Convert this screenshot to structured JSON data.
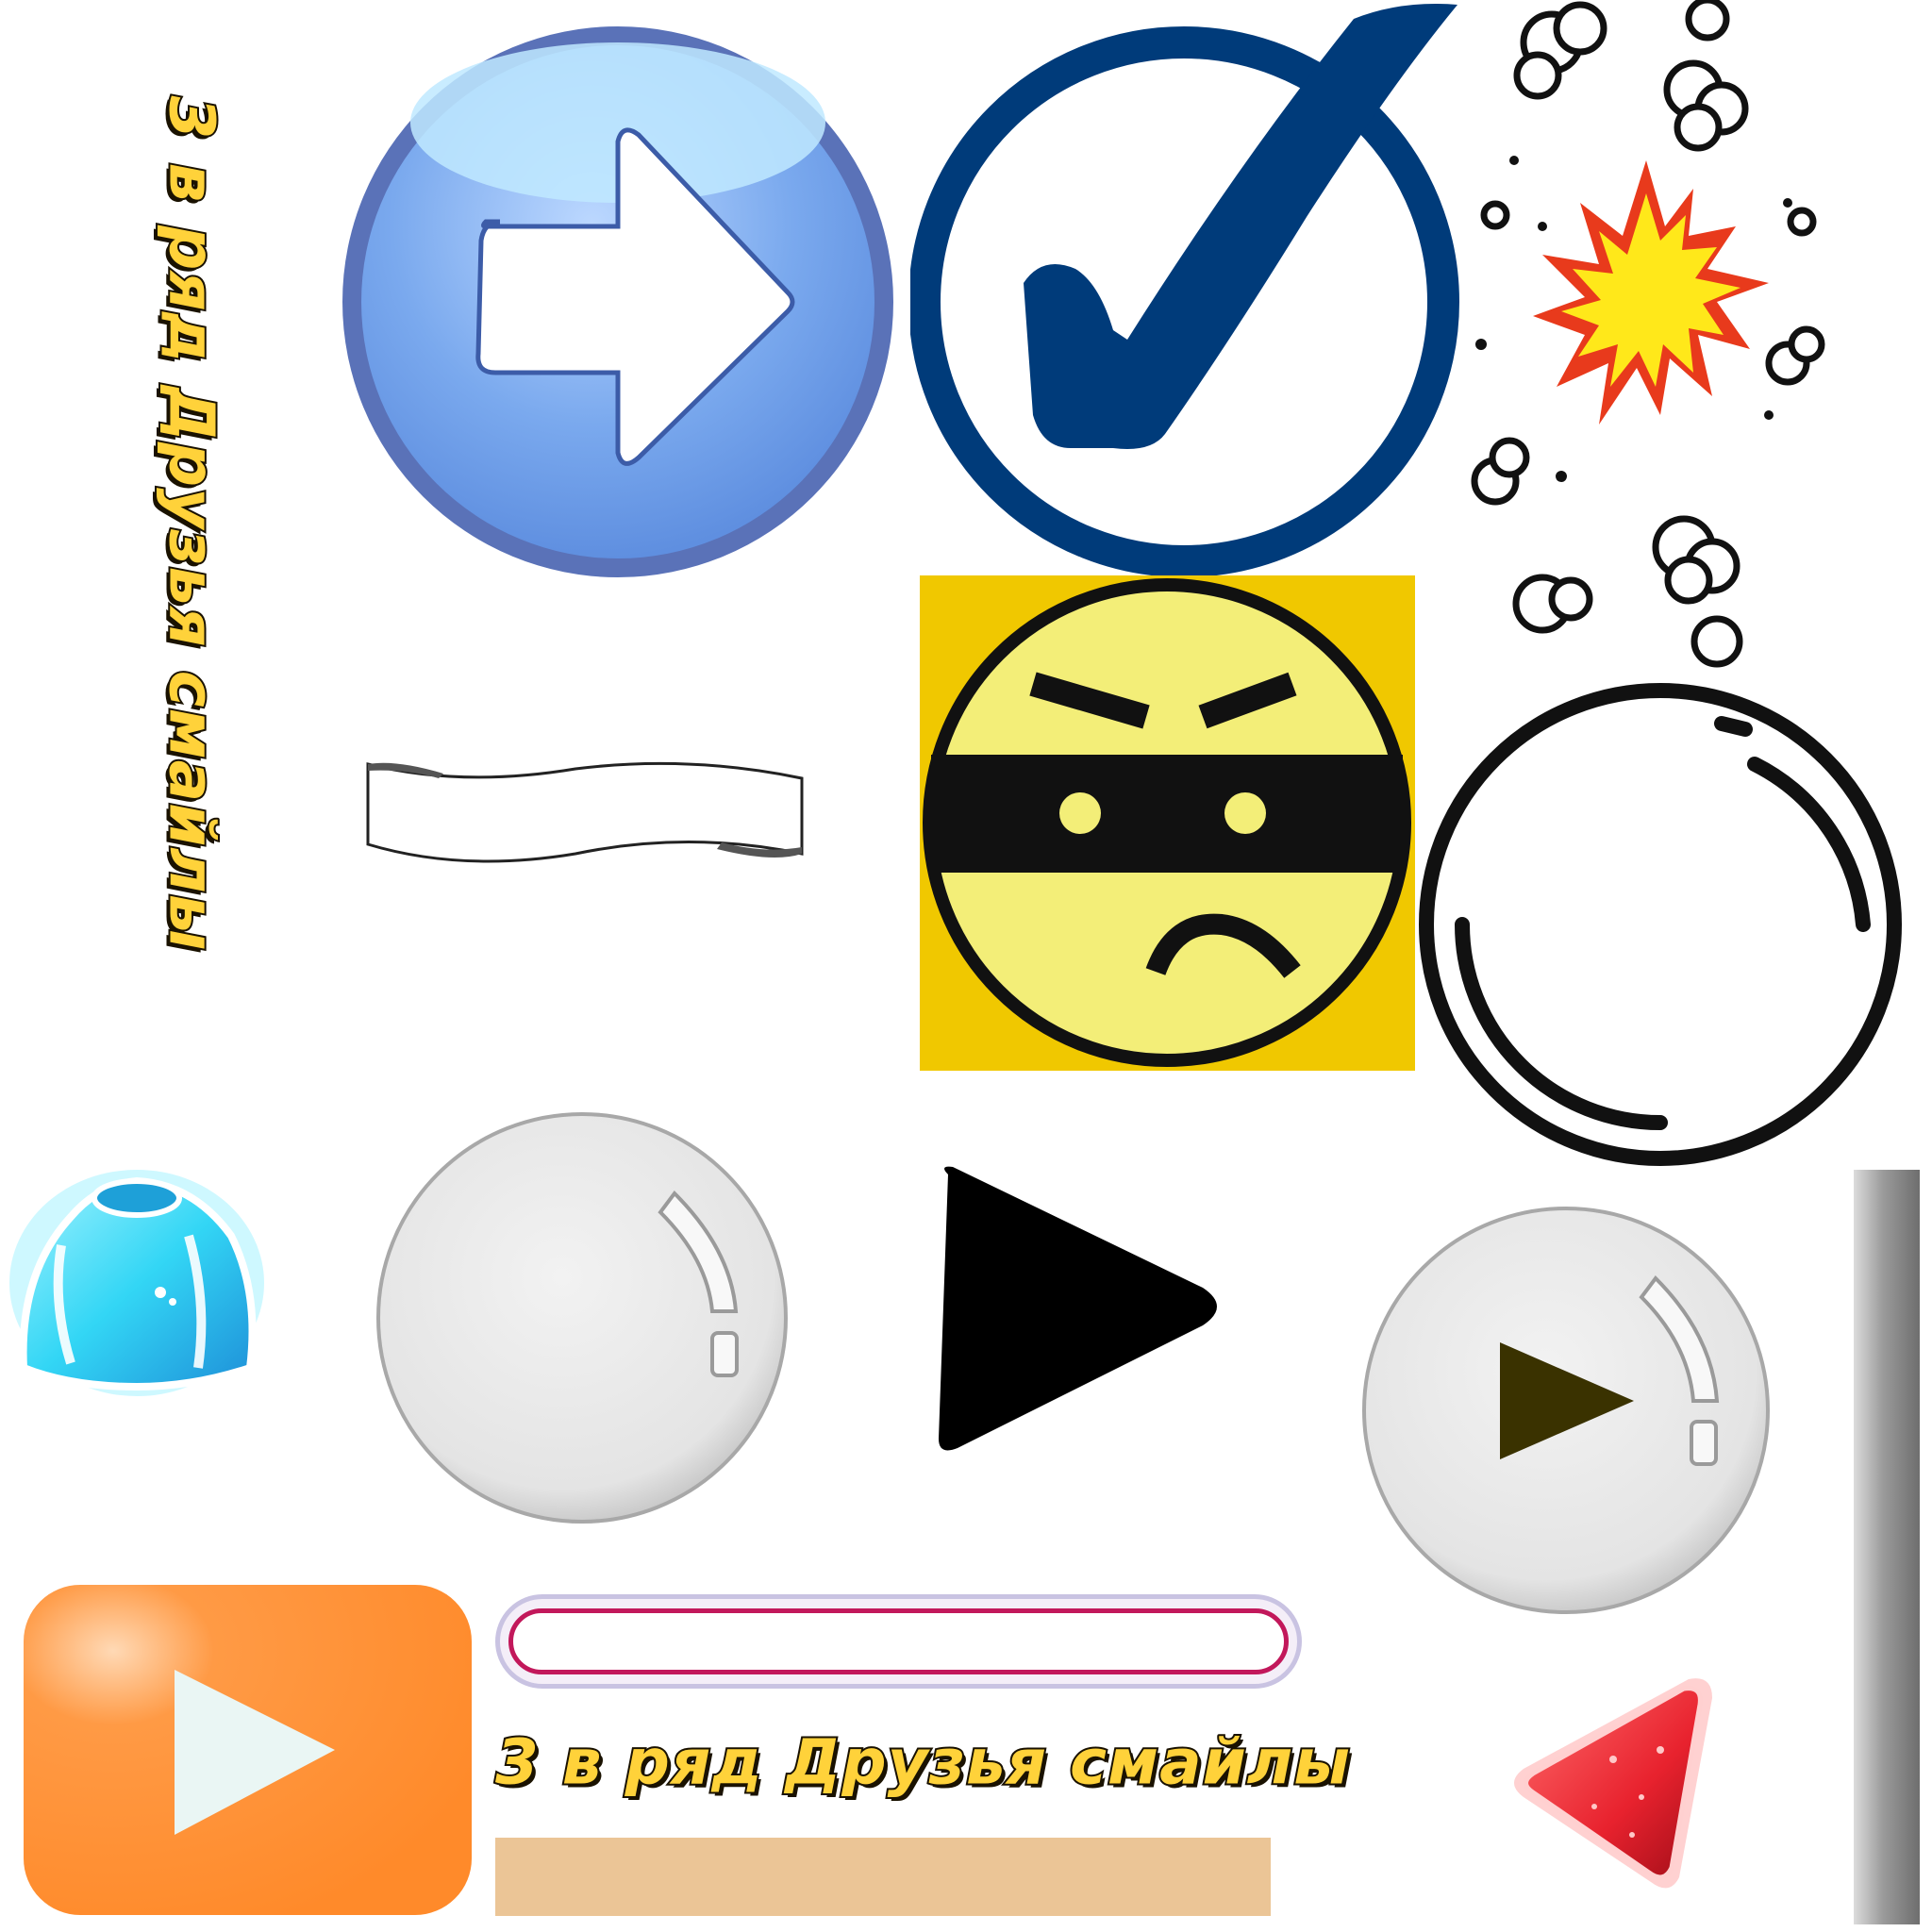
{
  "sprite_sheet": {
    "title_vertical": "3 в ряд Друзья смайлы",
    "title_horizontal": "3 в ряд Друзья смайлы",
    "progress_bar": {
      "value": 0
    }
  },
  "icons": [
    "arrow-right-icon",
    "checkmark-icon",
    "explosion-icon",
    "scroll-banner-icon",
    "masked-bandit-smiley-icon",
    "empty-circle-icon",
    "jelly-block-icon",
    "glass-button-icon",
    "play-icon",
    "glass-play-button-icon",
    "orange-play-button-icon",
    "red-gem-icon"
  ],
  "colors": {
    "blue_button": "#6a9be8",
    "blue_button_rim": "#5a72b8",
    "check_navy": "#003b7a",
    "explosion_yellow": "#ffe81a",
    "explosion_red": "#e83a1c",
    "smiley_bg": "#f0c800",
    "smiley_face": "#f3ee78",
    "jelly_cyan": "#33d6f5",
    "glass_grey": "#e8e8e8",
    "orange": "#ff8c2e",
    "play_olive": "#3a3200",
    "progress_magenta": "#c2185b",
    "tan": "#ebc596",
    "gem_red": "#e8222e"
  }
}
